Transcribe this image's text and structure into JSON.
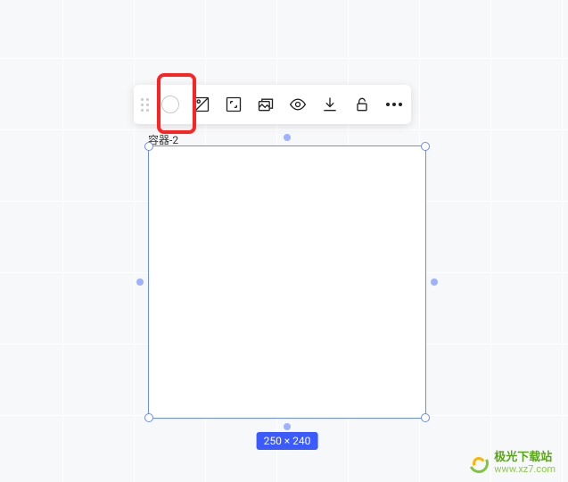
{
  "element": {
    "label": "容器-2",
    "size_badge": "250 × 240"
  },
  "toolbar": {
    "tools": {
      "drag": "drag-handle",
      "fill": "fill-circle",
      "image": "image",
      "resize": "auto-size",
      "replace": "replace-image",
      "preview": "eye",
      "download": "download",
      "lock": "unlock",
      "more": "more"
    }
  },
  "watermark": {
    "name": "极光下载站",
    "url": "www.xz7.com"
  }
}
